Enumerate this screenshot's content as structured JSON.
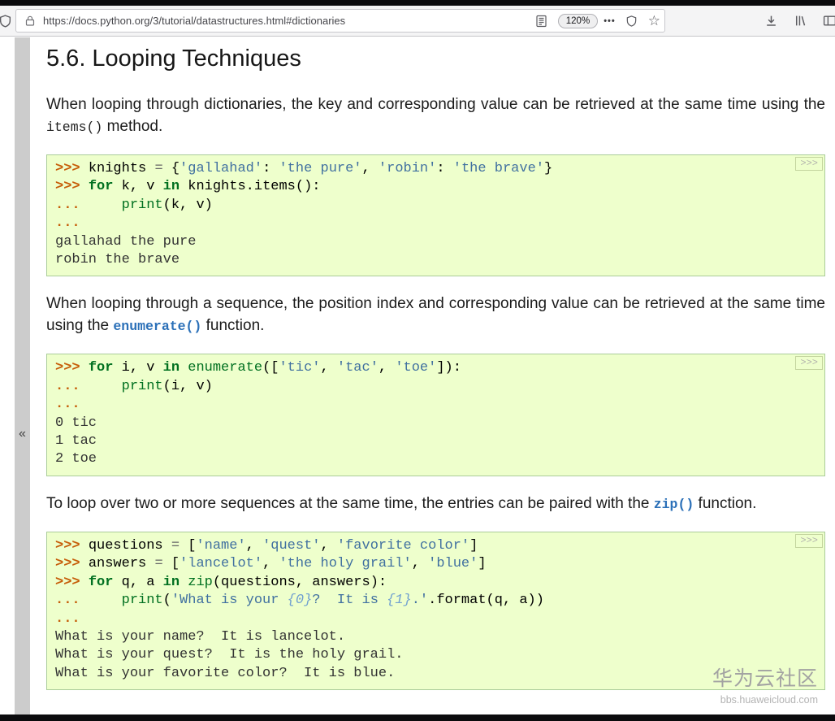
{
  "browser": {
    "url": "https://docs.python.org/3/tutorial/datastructures.html#dictionaries",
    "zoom": "120%",
    "page_actions_glyph": "•••",
    "bookmark_star_glyph": "☆",
    "icons": {
      "tracking_protection": "shield-icon",
      "site_security": "lock-icon",
      "reader_mode": "reader-page-icon",
      "page_actions": "ellipsis-icon",
      "protections": "shield-outline-icon",
      "bookmark": "star-outline-icon",
      "downloads": "down-arrow-icon",
      "library": "books-icon",
      "sidebar_toggle": "panel-icon"
    }
  },
  "sidebar": {
    "collapse_glyph": "«"
  },
  "content": {
    "heading": "5.6. Looping Techniques",
    "paragraphs": [
      {
        "segments": [
          {
            "style": "plain",
            "text": "When looping through dictionaries, the key and corresponding value can be retrieved at the same time using the "
          },
          {
            "style": "code",
            "text": "items()"
          },
          {
            "style": "plain",
            "text": " method."
          }
        ]
      },
      {
        "segments": [
          {
            "style": "plain",
            "text": "When looping through a sequence, the position index and corresponding value can be retrieved at the same time using the "
          },
          {
            "style": "code-link",
            "text": "enumerate()"
          },
          {
            "style": "plain",
            "text": " function."
          }
        ]
      },
      {
        "segments": [
          {
            "style": "plain",
            "text": "To loop over two or more sequences at the same time, the entries can be paired with the "
          },
          {
            "style": "code-link",
            "text": "zip()"
          },
          {
            "style": "plain",
            "text": " function."
          }
        ]
      }
    ],
    "code_blocks": [
      {
        "toggle_label": ">>>",
        "lines": [
          [
            {
              "c": "gp",
              "t": ">>> "
            },
            {
              "t": "knights "
            },
            {
              "c": "o",
              "t": "="
            },
            {
              "t": " {"
            },
            {
              "c": "s",
              "t": "'gallahad'"
            },
            {
              "t": ": "
            },
            {
              "c": "s",
              "t": "'the pure'"
            },
            {
              "t": ", "
            },
            {
              "c": "s",
              "t": "'robin'"
            },
            {
              "t": ": "
            },
            {
              "c": "s",
              "t": "'the brave'"
            },
            {
              "t": "}"
            }
          ],
          [
            {
              "c": "gp",
              "t": ">>> "
            },
            {
              "c": "k",
              "t": "for"
            },
            {
              "t": " k, v "
            },
            {
              "c": "k",
              "t": "in"
            },
            {
              "t": " knights.items():"
            }
          ],
          [
            {
              "c": "gp",
              "t": "... "
            },
            {
              "t": "    "
            },
            {
              "c": "nb",
              "t": "print"
            },
            {
              "t": "(k, v)"
            }
          ],
          [
            {
              "c": "gp",
              "t": "..."
            }
          ],
          [
            {
              "c": "go",
              "t": "gallahad the pure"
            }
          ],
          [
            {
              "c": "go",
              "t": "robin the brave"
            }
          ]
        ]
      },
      {
        "toggle_label": ">>>",
        "lines": [
          [
            {
              "c": "gp",
              "t": ">>> "
            },
            {
              "c": "k",
              "t": "for"
            },
            {
              "t": " i, v "
            },
            {
              "c": "k",
              "t": "in"
            },
            {
              "t": " "
            },
            {
              "c": "nb",
              "t": "enumerate"
            },
            {
              "t": "(["
            },
            {
              "c": "s",
              "t": "'tic'"
            },
            {
              "t": ", "
            },
            {
              "c": "s",
              "t": "'tac'"
            },
            {
              "t": ", "
            },
            {
              "c": "s",
              "t": "'toe'"
            },
            {
              "t": "]):"
            }
          ],
          [
            {
              "c": "gp",
              "t": "... "
            },
            {
              "t": "    "
            },
            {
              "c": "nb",
              "t": "print"
            },
            {
              "t": "(i, v)"
            }
          ],
          [
            {
              "c": "gp",
              "t": "..."
            }
          ],
          [
            {
              "c": "go",
              "t": "0 tic"
            }
          ],
          [
            {
              "c": "go",
              "t": "1 tac"
            }
          ],
          [
            {
              "c": "go",
              "t": "2 toe"
            }
          ]
        ]
      },
      {
        "toggle_label": ">>>",
        "lines": [
          [
            {
              "c": "gp",
              "t": ">>> "
            },
            {
              "t": "questions "
            },
            {
              "c": "o",
              "t": "="
            },
            {
              "t": " ["
            },
            {
              "c": "s",
              "t": "'name'"
            },
            {
              "t": ", "
            },
            {
              "c": "s",
              "t": "'quest'"
            },
            {
              "t": ", "
            },
            {
              "c": "s",
              "t": "'favorite color'"
            },
            {
              "t": "]"
            }
          ],
          [
            {
              "c": "gp",
              "t": ">>> "
            },
            {
              "t": "answers "
            },
            {
              "c": "o",
              "t": "="
            },
            {
              "t": " ["
            },
            {
              "c": "s",
              "t": "'lancelot'"
            },
            {
              "t": ", "
            },
            {
              "c": "s",
              "t": "'the holy grail'"
            },
            {
              "t": ", "
            },
            {
              "c": "s",
              "t": "'blue'"
            },
            {
              "t": "]"
            }
          ],
          [
            {
              "c": "gp",
              "t": ">>> "
            },
            {
              "c": "k",
              "t": "for"
            },
            {
              "t": " q, a "
            },
            {
              "c": "k",
              "t": "in"
            },
            {
              "t": " "
            },
            {
              "c": "nb",
              "t": "zip"
            },
            {
              "t": "(questions, answers):"
            }
          ],
          [
            {
              "c": "gp",
              "t": "... "
            },
            {
              "t": "    "
            },
            {
              "c": "nb",
              "t": "print"
            },
            {
              "t": "("
            },
            {
              "c": "s",
              "t": "'What is your "
            },
            {
              "c": "si",
              "t": "{0}"
            },
            {
              "c": "s",
              "t": "?  It is "
            },
            {
              "c": "si",
              "t": "{1}"
            },
            {
              "c": "s",
              "t": ".'"
            },
            {
              "t": ".format(q, a))"
            }
          ],
          [
            {
              "c": "gp",
              "t": "..."
            }
          ],
          [
            {
              "c": "go",
              "t": "What is your name?  It is lancelot."
            }
          ],
          [
            {
              "c": "go",
              "t": "What is your quest?  It is the holy grail."
            }
          ],
          [
            {
              "c": "go",
              "t": "What is your favorite color?  It is blue."
            }
          ]
        ]
      }
    ]
  },
  "watermark": {
    "title": "华为云社区",
    "subtitle": "bbs.huaweicloud.com"
  },
  "colors": {
    "code_background": "#eeffcc",
    "code_border": "#aacc99",
    "prompt": "#c65d09",
    "keyword": "#007020",
    "string": "#4070a0",
    "builtin": "#007020",
    "string_interpolation": "#70a0d0",
    "operator": "#666666",
    "output": "#333333",
    "code_link": "#2b70b8",
    "sidebar_strip": "#cccccc",
    "toolbar_background": "#f4f4f5"
  }
}
